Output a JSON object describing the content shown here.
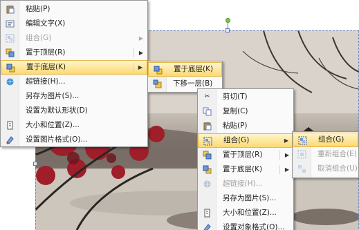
{
  "menu1": {
    "items": [
      {
        "label": "粘贴(P)",
        "icon": "paste-icon",
        "sub": false,
        "disabled": false
      },
      {
        "label": "编辑文字(X)",
        "icon": "edit-text-icon",
        "sub": false,
        "disabled": false
      },
      {
        "label": "组合(G)",
        "icon": "group-icon",
        "sub": true,
        "disabled": true
      },
      {
        "label": "置于顶层(R)",
        "icon": "bring-to-front-icon",
        "sub": true,
        "disabled": false
      },
      {
        "label": "置于底层(K)",
        "icon": "send-to-back-icon",
        "sub": true,
        "disabled": false,
        "highlight": true
      },
      {
        "label": "超链接(H)...",
        "icon": "hyperlink-icon",
        "sub": false,
        "disabled": false
      },
      {
        "label": "另存为图片(S)...",
        "icon": "",
        "sub": false,
        "disabled": false
      },
      {
        "label": "设置为默认形状(D)",
        "icon": "",
        "sub": false,
        "disabled": false
      },
      {
        "label": "大小和位置(Z)...",
        "icon": "size-position-icon",
        "sub": false,
        "disabled": false
      },
      {
        "label": "设置图片格式(O)...",
        "icon": "format-picture-icon",
        "sub": false,
        "disabled": false
      }
    ]
  },
  "menu2": {
    "items": [
      {
        "label": "置于底层(K)",
        "icon": "send-to-back-icon",
        "highlight": true
      },
      {
        "label": "下移一层(B)",
        "icon": "send-backward-icon",
        "highlight": false
      }
    ]
  },
  "menu3": {
    "items": [
      {
        "label": "剪切(T)",
        "icon": "cut-icon",
        "sub": false,
        "disabled": false
      },
      {
        "label": "复制(C)",
        "icon": "copy-icon",
        "sub": false,
        "disabled": false
      },
      {
        "label": "粘贴(P)",
        "icon": "paste-icon",
        "sub": false,
        "disabled": false
      },
      {
        "label": "组合(G)",
        "icon": "group-icon",
        "sub": true,
        "disabled": false,
        "highlight": true
      },
      {
        "label": "置于顶层(R)",
        "icon": "bring-to-front-icon",
        "sub": true,
        "disabled": false
      },
      {
        "label": "置于底层(K)",
        "icon": "send-to-back-icon",
        "sub": true,
        "disabled": false
      },
      {
        "label": "超链接(H)...",
        "icon": "hyperlink-icon",
        "sub": false,
        "disabled": true
      },
      {
        "label": "另存为图片(S)...",
        "icon": "",
        "sub": false,
        "disabled": false
      },
      {
        "label": "大小和位置(Z)...",
        "icon": "size-position-icon",
        "sub": false,
        "disabled": false
      },
      {
        "label": "设置对象格式(O)...",
        "icon": "format-object-icon",
        "sub": false,
        "disabled": false
      }
    ]
  },
  "menu4": {
    "items": [
      {
        "label": "组合(G)",
        "icon": "group-icon",
        "disabled": false,
        "highlight": true
      },
      {
        "label": "重新组合(E)",
        "icon": "regroup-icon",
        "disabled": true
      },
      {
        "label": "取消组合(U)",
        "icon": "ungroup-icon",
        "disabled": true
      }
    ]
  },
  "colors": {
    "highlight": "#fbd972",
    "menu_bg": "#fafafa",
    "gutter": "#f0f0f0",
    "disabled": "#a0a0a0",
    "foliage": "#9e1e2a"
  }
}
